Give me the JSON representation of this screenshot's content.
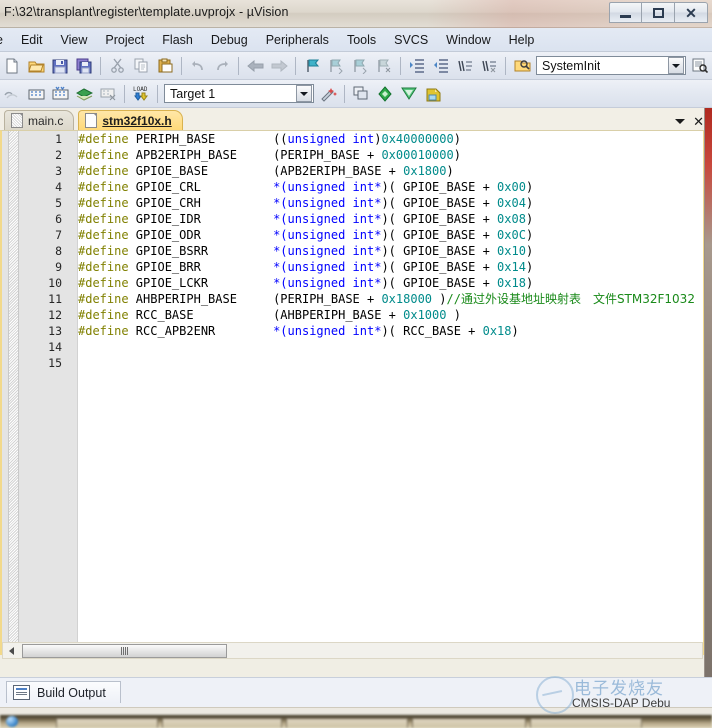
{
  "window": {
    "title": "F:\\32\\transplant\\register\\template.uvprojx - µVision",
    "minimize_label": "Minimize",
    "restore_label": "Restore",
    "close_label": "Close"
  },
  "menubar": {
    "items": [
      {
        "label": "e"
      },
      {
        "label": "Edit"
      },
      {
        "label": "View"
      },
      {
        "label": "Project"
      },
      {
        "label": "Flash"
      },
      {
        "label": "Debug"
      },
      {
        "label": "Peripherals"
      },
      {
        "label": "Tools"
      },
      {
        "label": "SVCS"
      },
      {
        "label": "Window"
      },
      {
        "label": "Help"
      }
    ]
  },
  "toolbar_row1": {
    "icons": [
      {
        "name": "new-file-icon"
      },
      {
        "name": "open-file-icon"
      },
      {
        "name": "save-icon"
      },
      {
        "name": "save-all-icon"
      },
      {
        "name": "cut-icon"
      },
      {
        "name": "copy-icon"
      },
      {
        "name": "paste-icon"
      },
      {
        "name": "undo-icon"
      },
      {
        "name": "redo-icon"
      },
      {
        "name": "navigate-back-icon"
      },
      {
        "name": "navigate-forward-icon"
      },
      {
        "name": "bookmark-toggle-icon"
      },
      {
        "name": "bookmark-prev-icon"
      },
      {
        "name": "bookmark-next-icon"
      },
      {
        "name": "bookmark-clear-icon"
      },
      {
        "name": "indent-icon"
      },
      {
        "name": "outdent-icon"
      },
      {
        "name": "comment-icon"
      },
      {
        "name": "uncomment-icon"
      },
      {
        "name": "find-in-files-icon"
      }
    ],
    "function_combo": {
      "value": "SystemInit",
      "placeholder": "SystemInit"
    },
    "right_icons": [
      {
        "name": "browse-symbols-icon"
      },
      {
        "name": "insert-marker-icon"
      }
    ]
  },
  "toolbar_row2": {
    "icons": [
      {
        "name": "translate-file-icon"
      },
      {
        "name": "build-target-icon"
      },
      {
        "name": "rebuild-all-icon"
      },
      {
        "name": "batch-build-icon"
      },
      {
        "name": "stop-build-icon"
      },
      {
        "name": "download-to-flash-icon"
      }
    ],
    "target_combo": {
      "value": "Target 1",
      "placeholder": "Target 1"
    },
    "after_icons": [
      {
        "name": "target-options-icon"
      },
      {
        "name": "manage-project-items-icon"
      },
      {
        "name": "multi-project-icon"
      },
      {
        "name": "configuration-wizard-icon"
      },
      {
        "name": "pack-installer-icon"
      },
      {
        "name": "manage-run-time-icon"
      }
    ]
  },
  "editor": {
    "tabs": [
      {
        "label": "main.c",
        "active": false
      },
      {
        "label": "stm32f10x.h",
        "active": true
      }
    ],
    "tab_controls": {
      "dropdown_label": "Active files list",
      "close_label": "Close document"
    },
    "lines": [
      {
        "n": "1",
        "tokens": [
          {
            "t": "#define",
            "c": "dir"
          },
          {
            "t": " PERIPH_BASE        ",
            "c": "id"
          },
          {
            "t": "((",
            "c": "id"
          },
          {
            "t": "unsigned int",
            "c": "kw"
          },
          {
            "t": ")",
            "c": "id"
          },
          {
            "t": "0x40000000",
            "c": "num"
          },
          {
            "t": ")",
            "c": "id"
          }
        ]
      },
      {
        "n": "2",
        "tokens": [
          {
            "t": "#define",
            "c": "dir"
          },
          {
            "t": " APB2ERIPH_BASE     (PERIPH_BASE + ",
            "c": "id"
          },
          {
            "t": "0x00010000",
            "c": "num"
          },
          {
            "t": ")",
            "c": "id"
          }
        ]
      },
      {
        "n": "3",
        "tokens": [
          {
            "t": "#define",
            "c": "dir"
          },
          {
            "t": " GPIOE_BASE         (APB2ERIPH_BASE + ",
            "c": "id"
          },
          {
            "t": "0x1800",
            "c": "num"
          },
          {
            "t": ")",
            "c": "id"
          }
        ]
      },
      {
        "n": "4",
        "tokens": [
          {
            "t": "#define",
            "c": "dir"
          },
          {
            "t": " GPIOE_CRL          ",
            "c": "id"
          },
          {
            "t": "*(",
            "c": "kw"
          },
          {
            "t": "unsigned int*",
            "c": "kw"
          },
          {
            "t": ")( GPIOE_BASE + ",
            "c": "id"
          },
          {
            "t": "0x00",
            "c": "num"
          },
          {
            "t": ")",
            "c": "id"
          }
        ]
      },
      {
        "n": "5",
        "tokens": [
          {
            "t": "#define",
            "c": "dir"
          },
          {
            "t": " GPIOE_CRH          ",
            "c": "id"
          },
          {
            "t": "*(",
            "c": "kw"
          },
          {
            "t": "unsigned int*",
            "c": "kw"
          },
          {
            "t": ")( GPIOE_BASE + ",
            "c": "id"
          },
          {
            "t": "0x04",
            "c": "num"
          },
          {
            "t": ")",
            "c": "id"
          }
        ]
      },
      {
        "n": "6",
        "tokens": [
          {
            "t": "#define",
            "c": "dir"
          },
          {
            "t": " GPIOE_IDR          ",
            "c": "id"
          },
          {
            "t": "*(",
            "c": "kw"
          },
          {
            "t": "unsigned int*",
            "c": "kw"
          },
          {
            "t": ")( GPIOE_BASE + ",
            "c": "id"
          },
          {
            "t": "0x08",
            "c": "num"
          },
          {
            "t": ")",
            "c": "id"
          }
        ]
      },
      {
        "n": "7",
        "tokens": [
          {
            "t": "#define",
            "c": "dir"
          },
          {
            "t": " GPIOE_ODR          ",
            "c": "id"
          },
          {
            "t": "*(",
            "c": "kw"
          },
          {
            "t": "unsigned int*",
            "c": "kw"
          },
          {
            "t": ")( GPIOE_BASE + ",
            "c": "id"
          },
          {
            "t": "0x0C",
            "c": "num"
          },
          {
            "t": ")",
            "c": "id"
          }
        ]
      },
      {
        "n": "8",
        "tokens": [
          {
            "t": "#define",
            "c": "dir"
          },
          {
            "t": " GPIOE_BSRR         ",
            "c": "id"
          },
          {
            "t": "*(",
            "c": "kw"
          },
          {
            "t": "unsigned int*",
            "c": "kw"
          },
          {
            "t": ")( GPIOE_BASE + ",
            "c": "id"
          },
          {
            "t": "0x10",
            "c": "num"
          },
          {
            "t": ")",
            "c": "id"
          }
        ]
      },
      {
        "n": "9",
        "tokens": [
          {
            "t": "#define",
            "c": "dir"
          },
          {
            "t": " GPIOE_BRR          ",
            "c": "id"
          },
          {
            "t": "*(",
            "c": "kw"
          },
          {
            "t": "unsigned int*",
            "c": "kw"
          },
          {
            "t": ")( GPIOE_BASE + ",
            "c": "id"
          },
          {
            "t": "0x14",
            "c": "num"
          },
          {
            "t": ")",
            "c": "id"
          }
        ]
      },
      {
        "n": "10",
        "tokens": [
          {
            "t": "#define",
            "c": "dir"
          },
          {
            "t": " GPIOE_LCKR         ",
            "c": "id"
          },
          {
            "t": "*(",
            "c": "kw"
          },
          {
            "t": "unsigned int*",
            "c": "kw"
          },
          {
            "t": ")( GPIOE_BASE + ",
            "c": "id"
          },
          {
            "t": "0x18",
            "c": "num"
          },
          {
            "t": ")",
            "c": "id"
          }
        ]
      },
      {
        "n": "11",
        "tokens": [
          {
            "t": "#define",
            "c": "dir"
          },
          {
            "t": " AHBPERIPH_BASE     (PERIPH_BASE + ",
            "c": "id"
          },
          {
            "t": "0x18000",
            "c": "num"
          },
          {
            "t": " )",
            "c": "id"
          },
          {
            "t": "//",
            "c": "cmt"
          },
          {
            "t": "通过外设基地址映射表　文件STM32F1032",
            "c": "cmt-cn"
          }
        ]
      },
      {
        "n": "12",
        "tokens": [
          {
            "t": "#define",
            "c": "dir"
          },
          {
            "t": " RCC_BASE           (AHBPERIPH_BASE + ",
            "c": "id"
          },
          {
            "t": "0x1000",
            "c": "num"
          },
          {
            "t": " )",
            "c": "id"
          }
        ]
      },
      {
        "n": "13",
        "tokens": [
          {
            "t": "#define",
            "c": "dir"
          },
          {
            "t": " RCC_APB2ENR        ",
            "c": "id"
          },
          {
            "t": "*(",
            "c": "kw"
          },
          {
            "t": "unsigned int*",
            "c": "kw"
          },
          {
            "t": ")( RCC_BASE + ",
            "c": "id"
          },
          {
            "t": "0x18",
            "c": "num"
          },
          {
            "t": ")",
            "c": "id"
          }
        ]
      },
      {
        "n": "14",
        "tokens": []
      },
      {
        "n": "15",
        "tokens": []
      }
    ],
    "hscroll": {
      "left_arrow_label": "Scroll left",
      "thumb_label": "Horizontal scroll thumb"
    }
  },
  "bottom_pane": {
    "tabs": [
      {
        "label": "Build Output",
        "icon": "build-output-icon"
      }
    ]
  },
  "watermark": {
    "chinese": "电子发烧友",
    "english": "CMSIS-DAP Debu"
  },
  "colors": {
    "directive": "#808000",
    "keyword": "#0000ff",
    "number": "#008b8b",
    "comment": "#1a8a1a",
    "tab_active": "#ffd978",
    "editor_border": "#f2d98b"
  }
}
